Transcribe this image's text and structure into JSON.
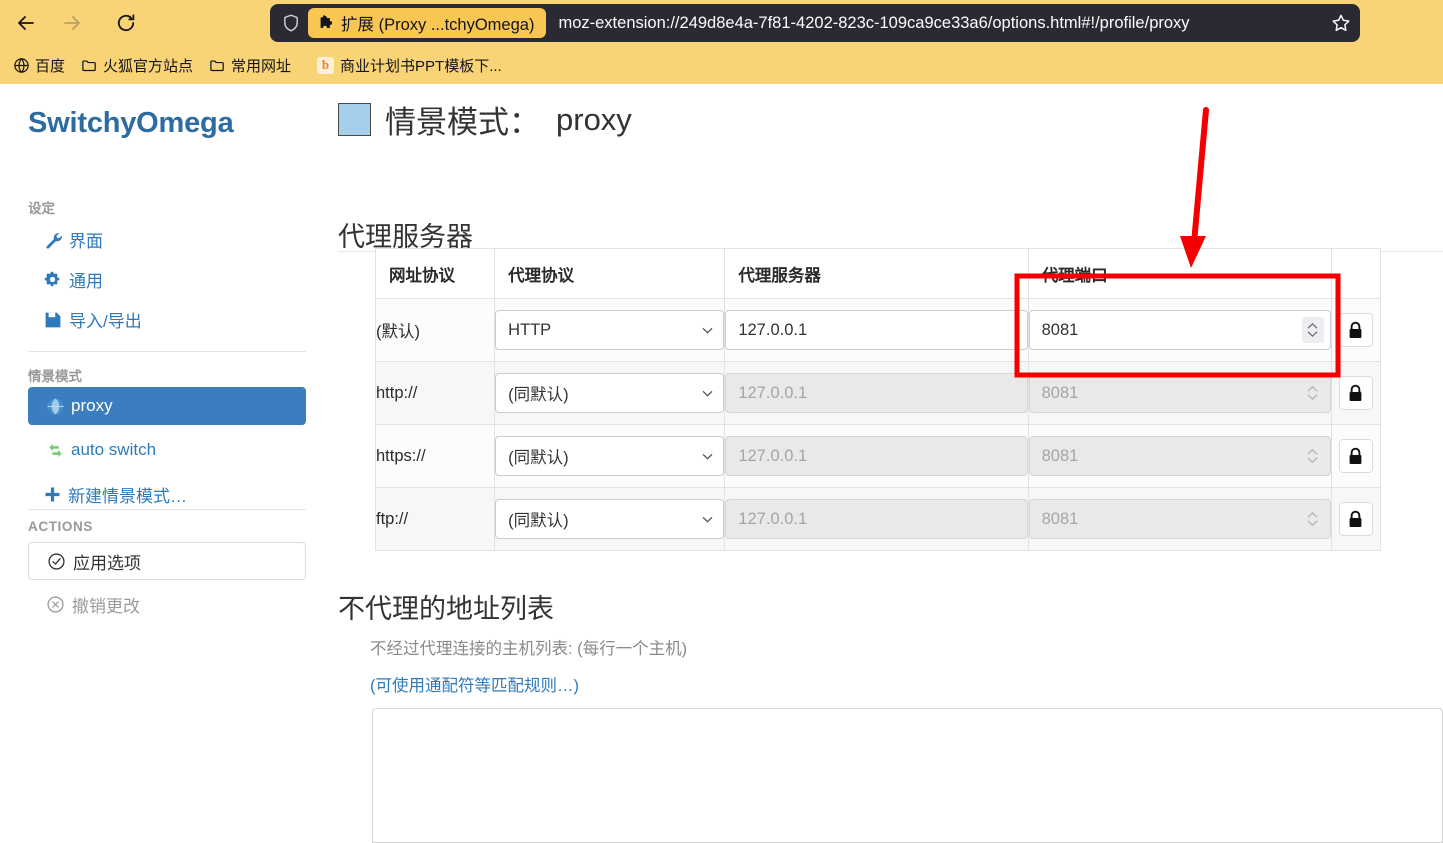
{
  "browser": {
    "back_label": "Back",
    "forward_label": "Forward",
    "reload_label": "Reload",
    "extension_chip": "扩展 (Proxy ...tchyOmega)",
    "url": "moz-extension://249d8e4a-7f81-4202-823c-109ca9ce33a6/options.html#!/profile/proxy",
    "bookmark_star_label": "Bookmark",
    "bookmarks": [
      {
        "label": "百度",
        "icon": "globe-icon"
      },
      {
        "label": "火狐官方站点",
        "icon": "folder-icon"
      },
      {
        "label": "常用网址",
        "icon": "folder-icon"
      },
      {
        "label": "商业计划书PPT模板下...",
        "icon": "b-favicon"
      }
    ],
    "colors": {
      "toolbar_bg": "#f8d477",
      "urlbar_bg": "#2b2a33",
      "chip_bg": "#f8c753"
    }
  },
  "sidebar": {
    "brand": "SwitchyOmega",
    "settings_title": "设定",
    "settings_items": [
      {
        "label": "界面",
        "icon": "wrench-icon"
      },
      {
        "label": "通用",
        "icon": "gear-icon"
      },
      {
        "label": "导入/导出",
        "icon": "save-icon"
      }
    ],
    "profiles_title": "情景模式",
    "profiles": [
      {
        "label": "proxy",
        "icon": "globe-icon",
        "active": true
      },
      {
        "label": "auto switch",
        "icon": "exchange-icon",
        "active": false
      },
      {
        "label": "新建情景模式…",
        "icon": "plus-icon",
        "active": false
      }
    ],
    "actions_title": "ACTIONS",
    "actions": [
      {
        "label": "应用选项",
        "icon": "check-circle-icon",
        "style": "button"
      },
      {
        "label": "撤销更改",
        "icon": "times-circle-icon",
        "style": "plain"
      }
    ],
    "colors": {
      "brand": "#2d6ca2",
      "link": "#2d7bbd",
      "active_bg": "#3a7ebf"
    }
  },
  "main": {
    "page_title_prefix": "情景模式：",
    "page_title_name": "proxy",
    "swatch_color": "#a6cfec",
    "proxy_section_title": "代理服务器",
    "table": {
      "headers": [
        "网址协议",
        "代理协议",
        "代理服务器",
        "代理端口",
        ""
      ],
      "rows": [
        {
          "scheme": "(默认)",
          "protocol": "HTTP",
          "server": "127.0.0.1",
          "port": "8081",
          "disabled": false,
          "lock_icon": "lock-icon"
        },
        {
          "scheme": "http://",
          "protocol": "(同默认)",
          "server": "127.0.0.1",
          "port": "8081",
          "disabled": true,
          "lock_icon": "lock-icon"
        },
        {
          "scheme": "https://",
          "protocol": "(同默认)",
          "server": "127.0.0.1",
          "port": "8081",
          "disabled": true,
          "lock_icon": "lock-icon"
        },
        {
          "scheme": "ftp://",
          "protocol": "(同默认)",
          "server": "127.0.0.1",
          "port": "8081",
          "disabled": true,
          "lock_icon": "lock-icon"
        }
      ]
    },
    "bypass_section_title": "不代理的地址列表",
    "bypass_help": "不经过代理连接的主机列表: (每行一个主机)",
    "bypass_link": "(可使用通配符等匹配规则…)",
    "bypass_value": ""
  },
  "annotation": {
    "arrow_color": "#f40000",
    "box_color": "#f40000",
    "highlight_target": "代理端口"
  }
}
